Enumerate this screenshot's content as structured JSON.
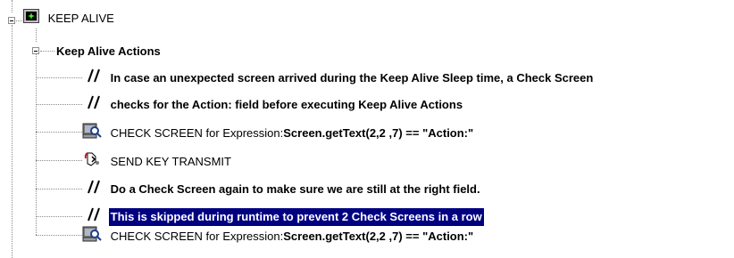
{
  "tree": {
    "root": {
      "label": "KEEP ALIVE",
      "icon": "keep-alive-module-icon"
    },
    "group": {
      "label": "Keep Alive Actions"
    },
    "items": [
      {
        "type": "comment",
        "icon": "comment-slashes-icon",
        "text": "In case an unexpected screen arrived during the Keep Alive Sleep time, a Check Screen"
      },
      {
        "type": "comment",
        "icon": "comment-slashes-icon",
        "text": "checks for the Action: field before executing Keep Alive Actions"
      },
      {
        "type": "check-screen",
        "icon": "check-screen-icon",
        "prefix": "CHECK SCREEN for Expression: ",
        "expression": "Screen.getText(2,2 ,7) == \"Action:\""
      },
      {
        "type": "send-key",
        "icon": "send-key-icon",
        "text": "SEND KEY TRANSMIT"
      },
      {
        "type": "comment",
        "icon": "comment-slashes-icon",
        "text": "Do a Check Screen again to make sure we are still at the right field."
      },
      {
        "type": "comment-selected",
        "icon": "comment-slashes-icon",
        "text": "This is skipped during runtime to prevent 2 Check Screens in a row"
      },
      {
        "type": "check-screen",
        "icon": "check-screen-icon",
        "prefix": "CHECK SCREEN for Expression: ",
        "expression": "Screen.getText(2,2 ,7) == \"Action:\""
      }
    ]
  },
  "colors": {
    "selection": "#000080",
    "tree_lines": "#8c8c8c"
  }
}
